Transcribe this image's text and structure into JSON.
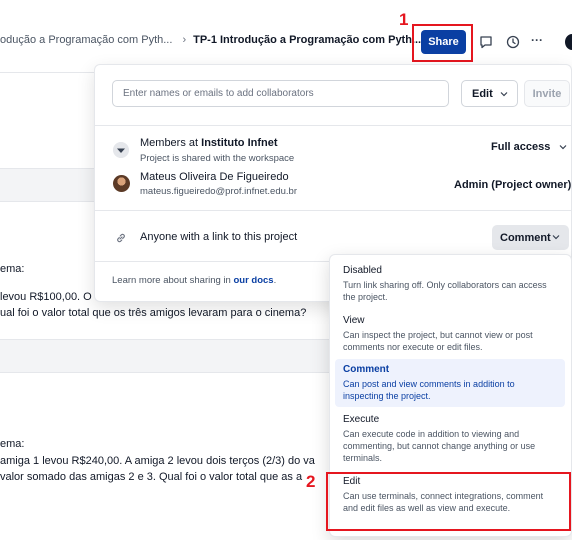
{
  "breadcrumb": {
    "crumb1": "odução a Programação com Pyth...",
    "separator": "›",
    "crumb2": "TP-1 Introdução a Programação com Pyth..."
  },
  "toolbar": {
    "share_label": "Share",
    "comment_icon": "comment-icon",
    "history_icon": "history-icon",
    "more_label": "···"
  },
  "annotations": {
    "marker1": "1",
    "marker2": "2",
    "color": "#e5161f"
  },
  "document": {
    "line1": "ema:",
    "line2": "levou R$100,00. O",
    "line3": "ual foi o valor total que os três amigos levaram para o cinema?",
    "line4": "ema:",
    "line5": " amiga 1 levou R$240,00. A amiga 2 levou dois terços (2/3) do va",
    "line6": "valor somado das amigas 2 e 3.  Qual foi o valor total que as a"
  },
  "share_panel": {
    "invite_placeholder": "Enter names or emails to add collaborators",
    "role_select": "Edit",
    "invite_label": "Invite",
    "members": {
      "prefix": "Members at ",
      "org": "Instituto Infnet",
      "subtitle": "Project is shared with the workspace",
      "access": "Full access"
    },
    "owner": {
      "name": "Mateus Oliveira De Figueiredo",
      "email": "mateus.figueiredo@prof.infnet.edu.br",
      "role": "Admin (Project owner)"
    },
    "link": {
      "label": "Anyone with a link to this project",
      "access": "Comment"
    },
    "footer": {
      "text": "Learn more about sharing in ",
      "link": "our docs",
      "suffix": "."
    }
  },
  "access_options": [
    {
      "title": "Disabled",
      "desc": "Turn link sharing off. Only collaborators can access the project."
    },
    {
      "title": "View",
      "desc": "Can inspect the project, but cannot view or post comments nor execute or edit files."
    },
    {
      "title": "Comment",
      "desc": "Can post and view comments in addition to inspecting the project."
    },
    {
      "title": "Execute",
      "desc": "Can execute code in addition to viewing and commenting, but cannot change anything or use terminals."
    },
    {
      "title": "Edit",
      "desc": "Can use terminals, connect integrations, comment and edit files as well as view and execute."
    }
  ],
  "colors": {
    "accent": "#0a3fa3",
    "highlight": "#e5161f",
    "selected_bg": "#eef2fd"
  }
}
